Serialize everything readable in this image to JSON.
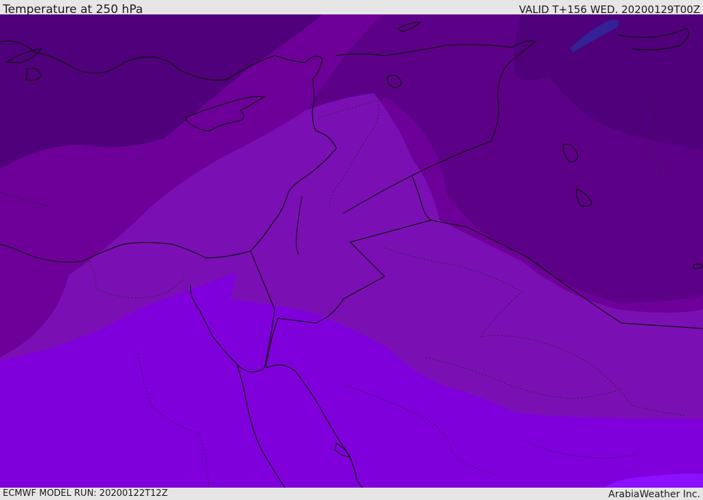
{
  "header": {
    "title": "Temperature at 250 hPa",
    "valid": "VALID T+156 WED. 20200129T00Z"
  },
  "footer": {
    "model_run": "ECMWF MODEL RUN: 20200122T12Z",
    "credit": "ArabiaWeather Inc."
  },
  "colors": {
    "band_darkest": "#4f007a",
    "band_dark": "#5c0088",
    "band_mid": "#6d0098",
    "band_light": "#7a10b4",
    "band_bright": "#8000dc",
    "band_brightest": "#8a10ff",
    "coast": "#111111"
  }
}
